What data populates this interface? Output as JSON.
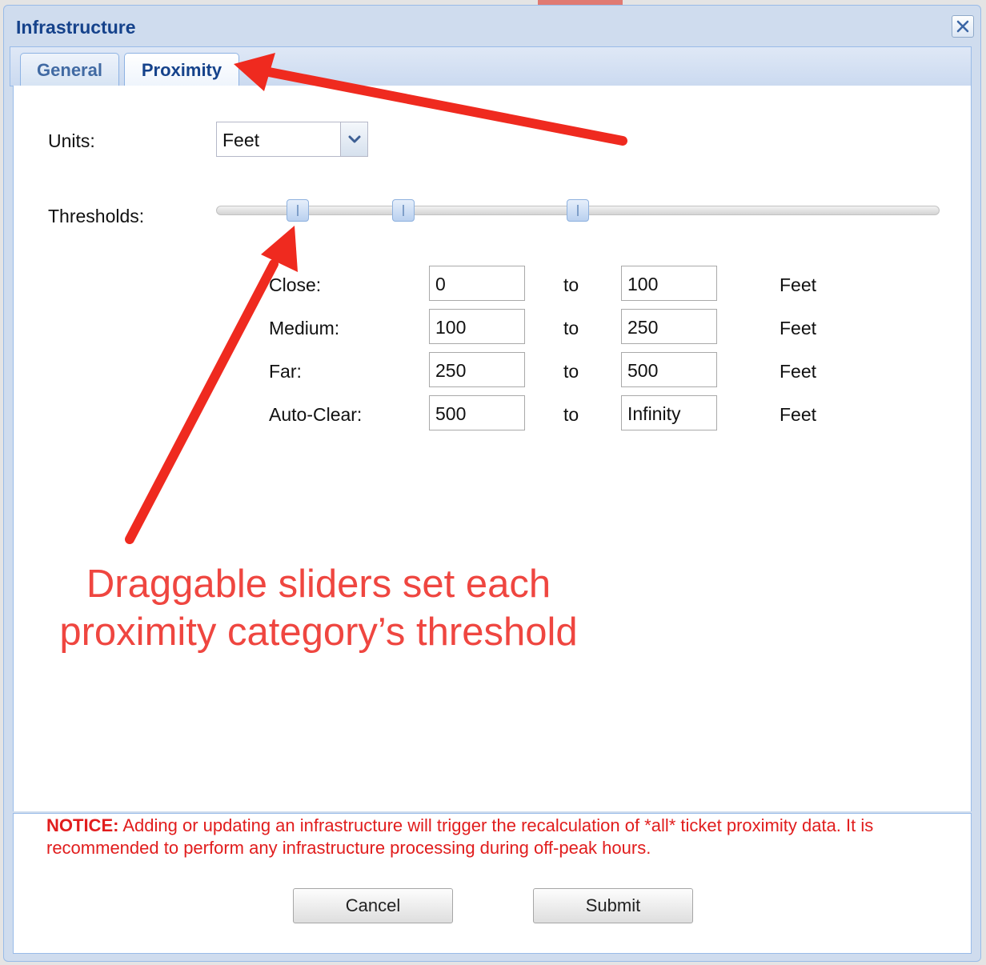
{
  "window": {
    "title": "Infrastructure"
  },
  "tabs": [
    {
      "label": "General",
      "active": false
    },
    {
      "label": "Proximity",
      "active": true
    }
  ],
  "form": {
    "units_label": "Units:",
    "units_value": "Feet",
    "thresholds_label": "Thresholds:",
    "rows": [
      {
        "label": "Close:",
        "from": "0",
        "to_word": "to",
        "to": "100",
        "unit": "Feet"
      },
      {
        "label": "Medium:",
        "from": "100",
        "to_word": "to",
        "to": "250",
        "unit": "Feet"
      },
      {
        "label": "Far:",
        "from": "250",
        "to_word": "to",
        "to": "500",
        "unit": "Feet"
      },
      {
        "label": "Auto-Clear:",
        "from": "500",
        "to_word": "to",
        "to": "Infinity",
        "unit": "Feet"
      }
    ]
  },
  "annotation": {
    "line1": "Draggable sliders set each",
    "line2": "proximity category’s threshold",
    "color": "#ef4640"
  },
  "notice": {
    "prefix": "NOTICE:",
    "text": "Adding or updating an infrastructure will trigger the recalculation of *all* ticket proximity data. It is recommended to perform any infrastructure processing during off-peak hours.",
    "color": "#e11d1d"
  },
  "buttons": {
    "cancel": "Cancel",
    "submit": "Submit"
  },
  "icons": {
    "close": "close-icon",
    "dropdown": "chevron-down-icon",
    "slider_thumb": "slider-thumb-icon"
  }
}
